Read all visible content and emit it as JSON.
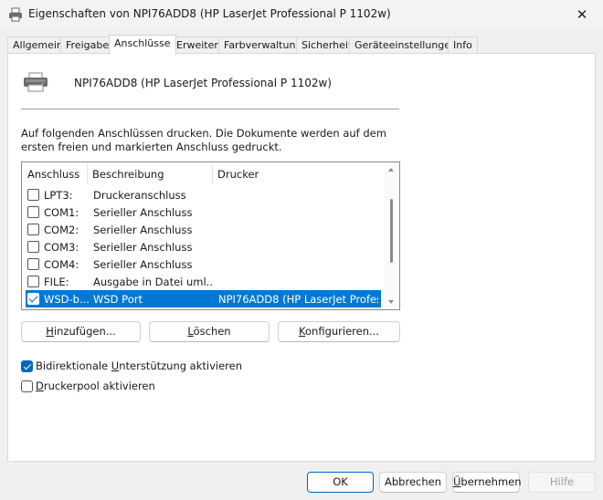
{
  "window": {
    "title": "Eigenschaften von NPI76ADD8 (HP LaserJet Professional P 1102w)",
    "close_glyph": "✕"
  },
  "tabs": [
    {
      "label": "Allgemein"
    },
    {
      "label": "Freigabe"
    },
    {
      "label": "Anschlüsse"
    },
    {
      "label": "Erweitert"
    },
    {
      "label": "Farbverwaltung"
    },
    {
      "label": "Sicherheit"
    },
    {
      "label": "Geräteeinstellungen"
    },
    {
      "label": "Info"
    }
  ],
  "active_tab": "Anschlüsse",
  "printer": {
    "name": "NPI76ADD8 (HP LaserJet Professional P 1102w)",
    "icon": "printer-icon"
  },
  "description": "Auf folgenden Anschlüssen drucken. Die Dokumente werden auf dem ersten freien und markierten Anschluss gedruckt.",
  "ports": {
    "columns": [
      "Anschluss",
      "Beschreibung",
      "Drucker"
    ],
    "rows": [
      {
        "port": "LPT3:",
        "description": "Druckeranschluss",
        "printer": "",
        "checked": false
      },
      {
        "port": "COM1:",
        "description": "Serieller Anschluss",
        "printer": "",
        "checked": false
      },
      {
        "port": "COM2:",
        "description": "Serieller Anschluss",
        "printer": "",
        "checked": false
      },
      {
        "port": "COM3:",
        "description": "Serieller Anschluss",
        "printer": "",
        "checked": false
      },
      {
        "port": "COM4:",
        "description": "Serieller Anschluss",
        "printer": "",
        "checked": false
      },
      {
        "port": "FILE:",
        "description": "Ausgabe in Datei uml...",
        "printer": "",
        "checked": false
      },
      {
        "port": "WSD-b...",
        "description": "WSD Port",
        "printer": "NPI76ADD8 (HP LaserJet Profes...",
        "checked": true,
        "selected": true
      }
    ]
  },
  "port_buttons": {
    "add": {
      "pre": "",
      "mnemonic": "H",
      "post": "inzufügen..."
    },
    "delete": {
      "pre": "",
      "mnemonic": "L",
      "post": "öschen"
    },
    "configure": {
      "pre": "",
      "mnemonic": "K",
      "post": "onfigurieren..."
    }
  },
  "options": {
    "bidirectional": {
      "pre": "Bidirektionale ",
      "mnemonic": "U",
      "post": "nterstützung aktivieren",
      "checked": true
    },
    "pool": {
      "pre": "",
      "mnemonic": "D",
      "post": "ruckerpool aktivieren",
      "checked": false
    }
  },
  "footer": {
    "ok": "OK",
    "cancel": "Abbrechen",
    "apply": {
      "pre": "",
      "mnemonic": "Ü",
      "post": "bernehmen"
    },
    "help": "Hilfe"
  },
  "colors": {
    "accent": "#0067c0",
    "selection": "#0078d4"
  }
}
